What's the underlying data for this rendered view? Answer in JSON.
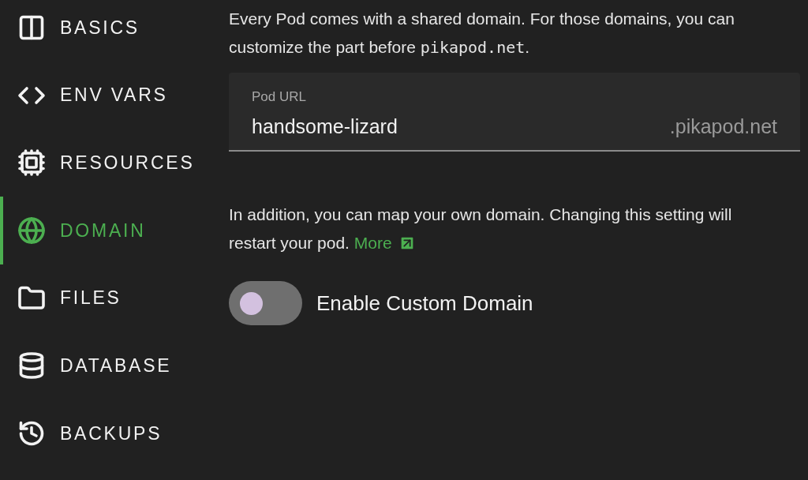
{
  "sidebar": {
    "items": [
      {
        "kind": "basics",
        "label": "BASICS",
        "selected": false
      },
      {
        "kind": "env",
        "label": "ENV VARS",
        "selected": false
      },
      {
        "kind": "resources",
        "label": "RESOURCES",
        "selected": false
      },
      {
        "kind": "domain",
        "label": "DOMAIN",
        "selected": true
      },
      {
        "kind": "files",
        "label": "FILES",
        "selected": false
      },
      {
        "kind": "database",
        "label": "DATABASE",
        "selected": false
      },
      {
        "kind": "backups",
        "label": "BACKUPS",
        "selected": false
      }
    ]
  },
  "intro": {
    "text_before": "Every Pod comes with a shared domain. For those domains, you can customize the part before ",
    "code": "pikapod.net",
    "text_after": "."
  },
  "pod_url_field": {
    "label": "Pod URL",
    "value": "handsome-lizard",
    "suffix": ".pikapod.net"
  },
  "custom_domain_note": {
    "text": "In addition, you can map your own domain. Changing this setting will restart your pod.",
    "link": "More"
  },
  "custom_domain_toggle": {
    "label": "Enable Custom Domain",
    "on": false
  }
}
